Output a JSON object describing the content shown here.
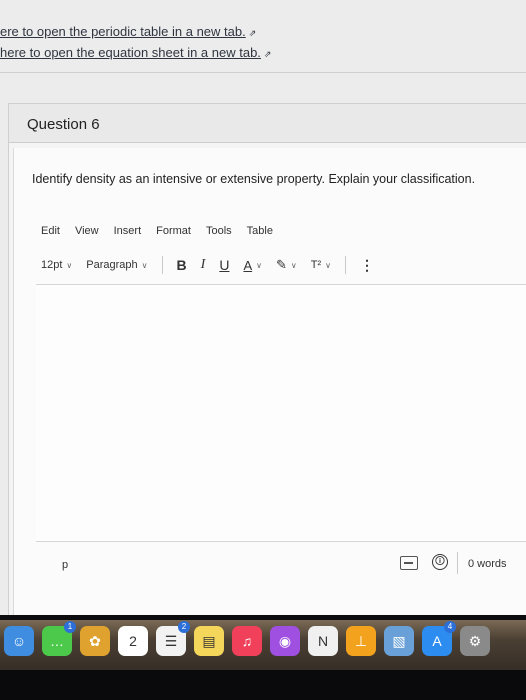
{
  "links": {
    "periodic": "ere to open the periodic table in a new tab.",
    "equation": "here to open the equation sheet in a new tab."
  },
  "question": {
    "title": "Question 6",
    "prompt": "Identify density as an intensive or extensive property. Explain your classification."
  },
  "editor": {
    "menu": [
      "Edit",
      "View",
      "Insert",
      "Format",
      "Tools",
      "Table"
    ],
    "font_size": "12pt",
    "block_format": "Paragraph",
    "bold": "B",
    "italic": "I",
    "underline": "U",
    "text_color": "A",
    "superscript": "T²",
    "more": "⋮",
    "status_path": "p",
    "word_count": "0 words",
    "accessibility": "🛈"
  },
  "dock": {
    "apps": [
      {
        "name": "Finder",
        "color": "#3f8de0",
        "glyph": "☺"
      },
      {
        "name": "Messages",
        "color": "#4cc94a",
        "glyph": "…",
        "badge": "1"
      },
      {
        "name": "Photos",
        "color": "#e0a22f",
        "glyph": "✿"
      },
      {
        "name": "Calendar",
        "color": "#ffffff",
        "glyph": "2"
      },
      {
        "name": "Reminders",
        "color": "#f2f2f2",
        "glyph": "☰",
        "badge": "2"
      },
      {
        "name": "Notes",
        "color": "#f4d65a",
        "glyph": "▤"
      },
      {
        "name": "Music",
        "color": "#f0405a",
        "glyph": "♫"
      },
      {
        "name": "Podcasts",
        "color": "#a050e0",
        "glyph": "◉"
      },
      {
        "name": "News",
        "color": "#f0f0f0",
        "glyph": "N"
      },
      {
        "name": "Keynote",
        "color": "#f3a21e",
        "glyph": "⊥"
      },
      {
        "name": "Preview",
        "color": "#6aa0d8",
        "glyph": "▧"
      },
      {
        "name": "App Store",
        "color": "#2d8cf0",
        "glyph": "A",
        "badge": "4"
      },
      {
        "name": "System Preferences",
        "color": "#8a8a8a",
        "glyph": "⚙"
      }
    ]
  }
}
